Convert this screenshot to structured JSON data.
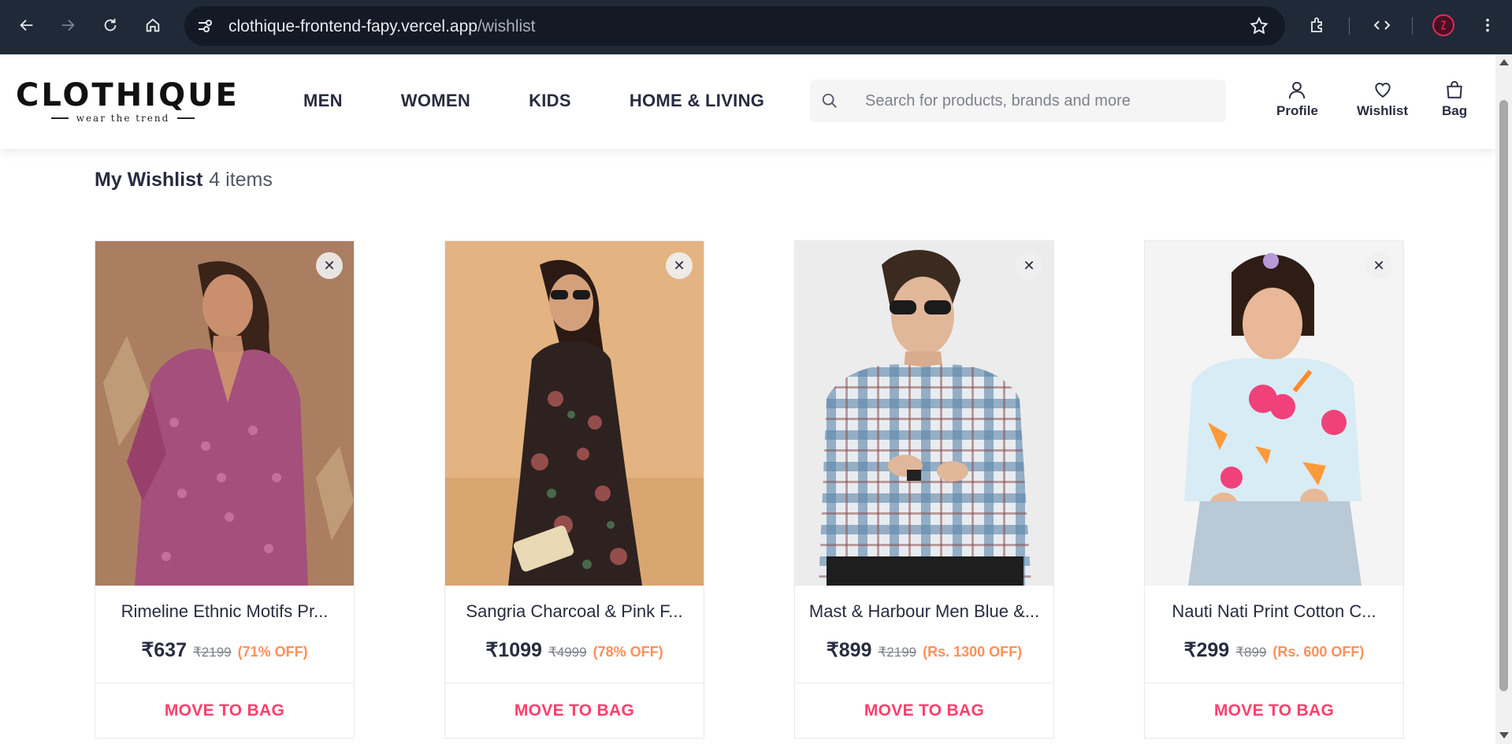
{
  "browser": {
    "url_host": "clothique-frontend-fapy.vercel.app",
    "url_path": "/wishlist"
  },
  "brand": {
    "name": "CLOTHIQUE",
    "tagline": "wear the trend"
  },
  "nav": {
    "items": [
      "MEN",
      "WOMEN",
      "KIDS",
      "HOME & LIVING"
    ]
  },
  "search": {
    "placeholder": "Search for products, brands and more"
  },
  "header_actions": {
    "profile": "Profile",
    "wishlist": "Wishlist",
    "bag": "Bag"
  },
  "wishlist": {
    "title": "My Wishlist",
    "count": "4 items",
    "move_label": "MOVE TO BAG",
    "items": [
      {
        "name": "Rimeline Ethnic Motifs Pr...",
        "price": "₹637",
        "mrp": "₹2199",
        "discount": "(71% OFF)"
      },
      {
        "name": "Sangria Charcoal & Pink F...",
        "price": "₹1099",
        "mrp": "₹4999",
        "discount": "(78% OFF)"
      },
      {
        "name": "Mast & Harbour Men Blue &...",
        "price": "₹899",
        "mrp": "₹2199",
        "discount": "(Rs. 1300 OFF)"
      },
      {
        "name": "Nauti Nati Print Cotton C...",
        "price": "₹299",
        "mrp": "₹899",
        "discount": "(Rs. 600 OFF)"
      }
    ]
  },
  "colors": {
    "brand_pink": "#ff3f6c",
    "discount_orange": "#ff905a",
    "text_dark": "#282c3f",
    "chrome_bg": "#1f2937"
  }
}
